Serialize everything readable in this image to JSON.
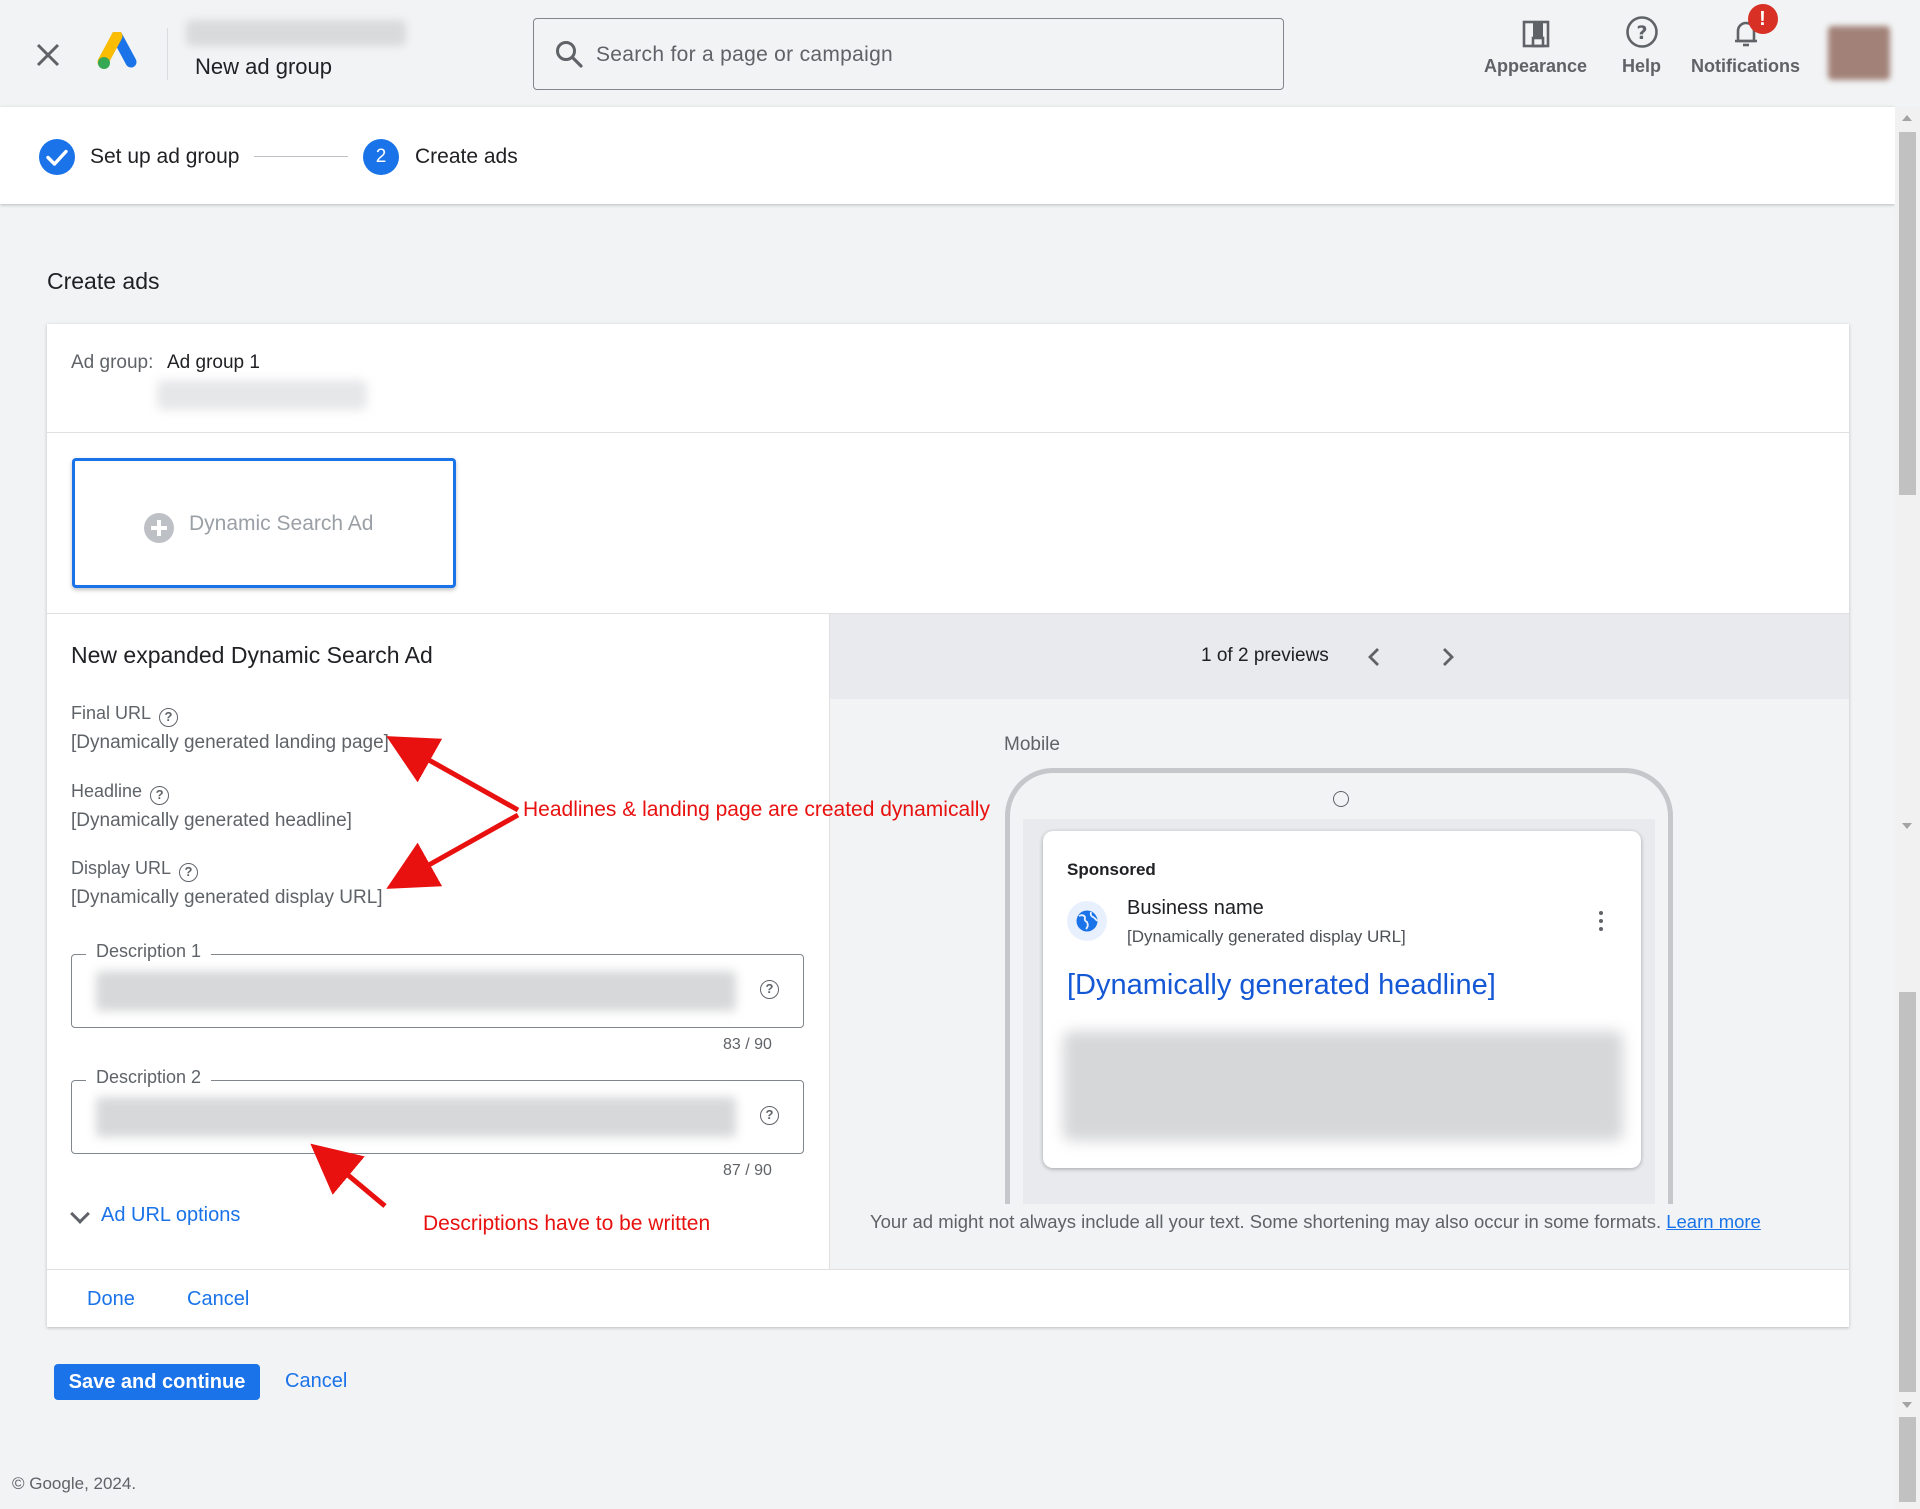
{
  "header": {
    "page_title": "New ad group",
    "search": {
      "placeholder": "Search for a page or campaign"
    },
    "actions": [
      {
        "label": "Appearance",
        "icon": "appearance-icon"
      },
      {
        "label": "Help",
        "icon": "help-icon"
      },
      {
        "label": "Notifications",
        "icon": "bell-icon",
        "badge": "!"
      }
    ]
  },
  "stepper": {
    "steps": [
      {
        "label": "Set up ad group",
        "state": "complete"
      },
      {
        "label": "Create ads",
        "number": "2",
        "state": "current"
      }
    ]
  },
  "main": {
    "section_title": "Create ads",
    "ad_group": {
      "label": "Ad group:",
      "value": "Ad group 1"
    },
    "ad_type_button": "Dynamic Search Ad",
    "editor": {
      "title": "New expanded Dynamic Search Ad",
      "final_url": {
        "label": "Final URL",
        "value": "[Dynamically generated landing page]"
      },
      "headline": {
        "label": "Headline",
        "value": "[Dynamically generated headline]"
      },
      "display_url": {
        "label": "Display URL",
        "value": "[Dynamically generated display URL]"
      },
      "description1": {
        "label": "Description 1",
        "counter": "83 / 90"
      },
      "description2": {
        "label": "Description 2",
        "counter": "87 / 90"
      },
      "ad_url_options": "Ad URL options"
    },
    "preview": {
      "count": "1 of 2 previews",
      "device_label": "Mobile",
      "ad": {
        "sponsored": "Sponsored",
        "business_name": "Business name",
        "display_url": "[Dynamically generated display URL]",
        "headline": "[Dynamically generated headline]"
      },
      "note": "Your ad might not always include all your text. Some shortening may also occur in some formats.",
      "learn_more": "Learn more"
    },
    "card_footer": {
      "done": "Done",
      "cancel": "Cancel"
    }
  },
  "footer": {
    "save_continue": "Save and continue",
    "cancel": "Cancel",
    "copyright": "© Google, 2024."
  },
  "annotations": {
    "headlines_note": "Headlines & landing page are created dynamically",
    "descriptions_note": "Descriptions have to be written",
    "color": "#e8110f"
  },
  "colors": {
    "accent": "#1a73e8",
    "alert": "#d93025",
    "background": "#f1f3f4"
  }
}
